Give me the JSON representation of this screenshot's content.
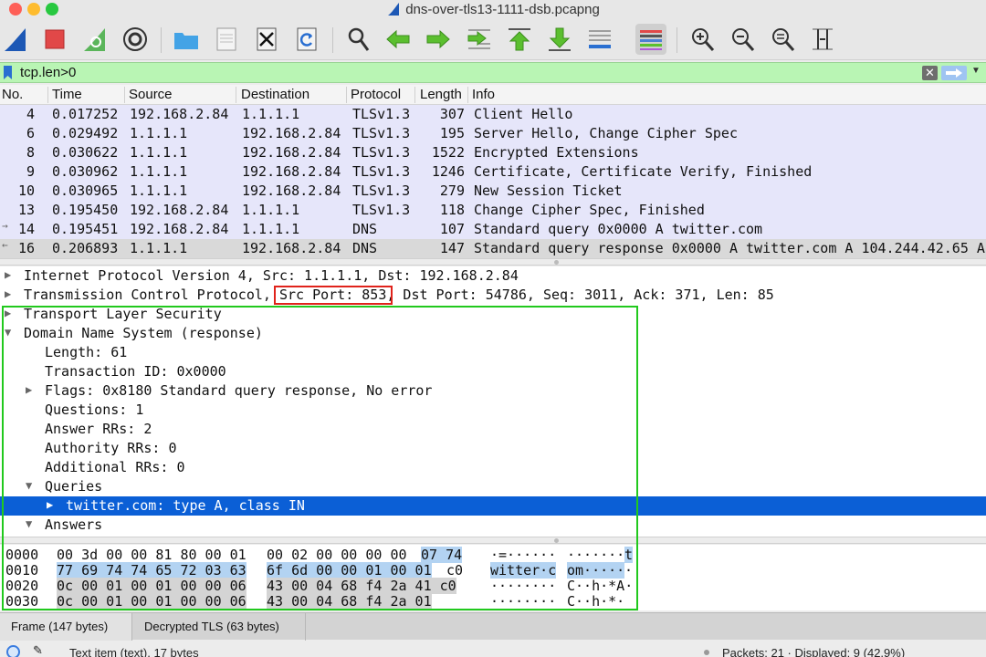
{
  "window": {
    "title": "dns-over-tls13-1111-dsb.pcapng"
  },
  "toolbar": {
    "buttons": [
      {
        "name": "start-capture-icon"
      },
      {
        "name": "stop-capture-icon"
      },
      {
        "name": "restart-capture-icon"
      },
      {
        "name": "capture-options-icon"
      },
      {
        "name": "open-file-icon"
      },
      {
        "name": "save-file-icon"
      },
      {
        "name": "close-file-icon"
      },
      {
        "name": "reload-file-icon"
      },
      {
        "name": "find-packet-icon"
      },
      {
        "name": "go-back-icon"
      },
      {
        "name": "go-forward-icon"
      },
      {
        "name": "go-to-packet-icon"
      },
      {
        "name": "go-first-packet-icon"
      },
      {
        "name": "go-last-packet-icon"
      },
      {
        "name": "auto-scroll-icon"
      },
      {
        "name": "colorize-icon"
      },
      {
        "name": "zoom-in-icon"
      },
      {
        "name": "zoom-out-icon"
      },
      {
        "name": "normal-size-icon"
      },
      {
        "name": "resize-columns-icon"
      }
    ]
  },
  "filter": {
    "value": "tcp.len>0",
    "colors": {
      "valid": "#b9f5b4"
    }
  },
  "packet_list": {
    "columns": [
      "No.",
      "Time",
      "Source",
      "Destination",
      "Protocol",
      "Length",
      "Info"
    ],
    "rows": [
      {
        "no": "4",
        "time": "0.017252",
        "src": "192.168.2.84",
        "dst": "1.1.1.1",
        "proto": "TLSv1.3",
        "len": "307",
        "info": "Client Hello"
      },
      {
        "no": "6",
        "time": "0.029492",
        "src": "1.1.1.1",
        "dst": "192.168.2.84",
        "proto": "TLSv1.3",
        "len": "195",
        "info": "Server Hello, Change Cipher Spec"
      },
      {
        "no": "8",
        "time": "0.030622",
        "src": "1.1.1.1",
        "dst": "192.168.2.84",
        "proto": "TLSv1.3",
        "len": "1522",
        "info": "Encrypted Extensions"
      },
      {
        "no": "9",
        "time": "0.030962",
        "src": "1.1.1.1",
        "dst": "192.168.2.84",
        "proto": "TLSv1.3",
        "len": "1246",
        "info": "Certificate, Certificate Verify, Finished"
      },
      {
        "no": "10",
        "time": "0.030965",
        "src": "1.1.1.1",
        "dst": "192.168.2.84",
        "proto": "TLSv1.3",
        "len": "279",
        "info": "New Session Ticket"
      },
      {
        "no": "13",
        "time": "0.195450",
        "src": "192.168.2.84",
        "dst": "1.1.1.1",
        "proto": "TLSv1.3",
        "len": "118",
        "info": "Change Cipher Spec, Finished"
      },
      {
        "no": "14",
        "time": "0.195451",
        "src": "192.168.2.84",
        "dst": "1.1.1.1",
        "proto": "DNS",
        "len": "107",
        "info": "Standard query 0x0000 A twitter.com"
      },
      {
        "no": "16",
        "time": "0.206893",
        "src": "1.1.1.1",
        "dst": "192.168.2.84",
        "proto": "DNS",
        "len": "147",
        "info": "Standard query response 0x0000 A twitter.com A 104.244.42.65 A"
      }
    ],
    "colors": {
      "row_bg": "#e6e6fa",
      "selected_bg": "#d9d9d9"
    }
  },
  "details": {
    "lines": [
      {
        "arrow": "▶",
        "text": "Internet Protocol Version 4, Src: 1.1.1.1, Dst: 192.168.2.84"
      },
      {
        "arrow": "▶",
        "text": "Transmission Control Protocol, Src Port: 853, Dst Port: 54786, Seq: 3011, Ack: 371, Len: 85"
      },
      {
        "arrow": "▶",
        "text": "Transport Layer Security"
      },
      {
        "arrow": "▼",
        "text": "Domain Name System (response)"
      },
      {
        "arrow": "",
        "text": "Length: 61"
      },
      {
        "arrow": "",
        "text": "Transaction ID: 0x0000"
      },
      {
        "arrow": "▶",
        "text": "Flags: 0x8180 Standard query response, No error"
      },
      {
        "arrow": "",
        "text": "Questions: 1"
      },
      {
        "arrow": "",
        "text": "Answer RRs: 2"
      },
      {
        "arrow": "",
        "text": "Authority RRs: 0"
      },
      {
        "arrow": "",
        "text": "Additional RRs: 0"
      },
      {
        "arrow": "▼",
        "text": "Queries"
      },
      {
        "arrow": "▶",
        "text": "twitter.com: type A, class IN"
      },
      {
        "arrow": "▼",
        "text": "Answers"
      }
    ],
    "colors": {
      "selected_bg": "#0b5fd6",
      "highlight_red": "#e0231b",
      "highlight_green": "#21c91d"
    }
  },
  "bytes": {
    "rows": [
      {
        "offset": "0000",
        "hex_a": "00 3d 00 00 81 80 00 01",
        "hex_b1": "00 02 00 00 00 00",
        "hex_b2": "07 74",
        "ascii_a": "·=······",
        "ascii_b1": "·······",
        "ascii_b2": "t"
      },
      {
        "offset": "0010",
        "hex_a": "77 69 74 74 65 72 03 63",
        "hex_b1": "6f 6d 00 00 01 00 01",
        "hex_b2": "c0",
        "ascii_a": "witter·c",
        "ascii_b1": "om·····",
        "ascii_b2": "·"
      },
      {
        "offset": "0020",
        "hex_a": "0c 00 01 00 01 00 00 06",
        "hex_b1": "43 00 04 68 f4 2a 41 c0",
        "hex_b2": "",
        "ascii_a": "········",
        "ascii_b1": "C··h·*A·",
        "ascii_b2": ""
      },
      {
        "offset": "0030",
        "hex_a": "0c 00 01 00 01 00 00 06",
        "hex_b1": "43 00 04 68 f4 2a 01",
        "hex_b2": "",
        "ascii_a": "········",
        "ascii_b1": "C··h·*·",
        "ascii_b2": ""
      }
    ],
    "colors": {
      "highlight": "#b3d3f2"
    }
  },
  "tabs": [
    {
      "label": "Frame (147 bytes)"
    },
    {
      "label": "Decrypted TLS (63 bytes)"
    }
  ],
  "status": {
    "left": "Text item (text), 17 bytes",
    "right": "Packets: 21 · Displayed: 9 (42.9%)"
  }
}
